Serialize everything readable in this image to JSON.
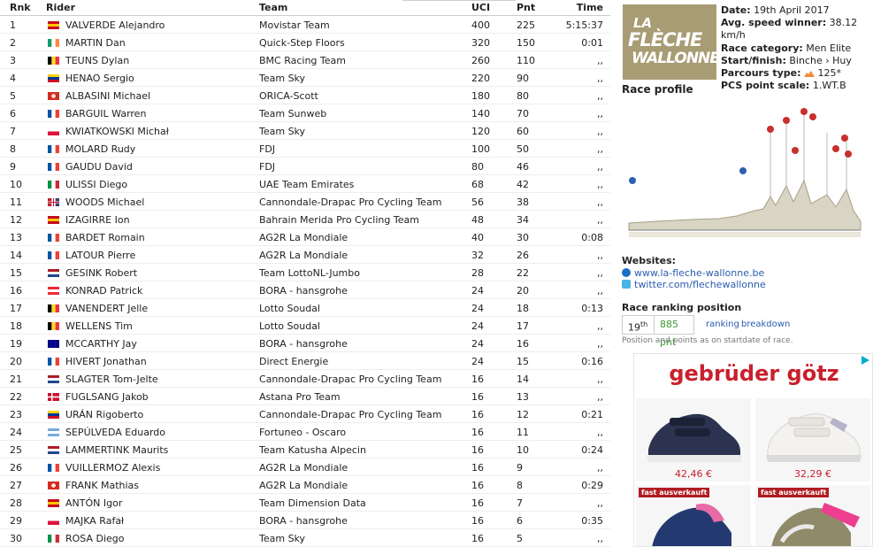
{
  "table": {
    "headers": {
      "rnk": "Rnk",
      "rider": "Rider",
      "team": "Team",
      "uci": "UCI",
      "pnt": "Pnt",
      "time": "Time"
    },
    "rows": [
      {
        "rnk": "1",
        "flag": "ES",
        "rider": "VALVERDE Alejandro",
        "team": "Movistar Team",
        "uci": "400",
        "pnt": "225",
        "time": "5:15:37"
      },
      {
        "rnk": "2",
        "flag": "IE",
        "rider": "MARTIN Dan",
        "team": "Quick-Step Floors",
        "uci": "320",
        "pnt": "150",
        "time": "0:01"
      },
      {
        "rnk": "3",
        "flag": "BE",
        "rider": "TEUNS Dylan",
        "team": "BMC Racing Team",
        "uci": "260",
        "pnt": "110",
        "time": ",,"
      },
      {
        "rnk": "4",
        "flag": "CO",
        "rider": "HENAO Sergio",
        "team": "Team Sky",
        "uci": "220",
        "pnt": "90",
        "time": ",,"
      },
      {
        "rnk": "5",
        "flag": "CH",
        "rider": "ALBASINI Michael",
        "team": "ORICA-Scott",
        "uci": "180",
        "pnt": "80",
        "time": ",,"
      },
      {
        "rnk": "6",
        "flag": "FR",
        "rider": "BARGUIL Warren",
        "team": "Team Sunweb",
        "uci": "140",
        "pnt": "70",
        "time": ",,"
      },
      {
        "rnk": "7",
        "flag": "PL",
        "rider": "KWIATKOWSKI Michał",
        "team": "Team Sky",
        "uci": "120",
        "pnt": "60",
        "time": ",,"
      },
      {
        "rnk": "8",
        "flag": "FR",
        "rider": "MOLARD Rudy",
        "team": "FDJ",
        "uci": "100",
        "pnt": "50",
        "time": ",,"
      },
      {
        "rnk": "9",
        "flag": "FR",
        "rider": "GAUDU David",
        "team": "FDJ",
        "uci": "80",
        "pnt": "46",
        "time": ",,"
      },
      {
        "rnk": "10",
        "flag": "IT",
        "rider": "ULISSI Diego",
        "team": "UAE Team Emirates",
        "uci": "68",
        "pnt": "42",
        "time": ",,"
      },
      {
        "rnk": "11",
        "flag": "GB",
        "rider": "WOODS Michael",
        "team": "Cannondale-Drapac Pro Cycling Team",
        "uci": "56",
        "pnt": "38",
        "time": ",,"
      },
      {
        "rnk": "12",
        "flag": "ES",
        "rider": "IZAGIRRE Ion",
        "team": "Bahrain Merida Pro Cycling Team",
        "uci": "48",
        "pnt": "34",
        "time": ",,"
      },
      {
        "rnk": "13",
        "flag": "FR",
        "rider": "BARDET Romain",
        "team": "AG2R La Mondiale",
        "uci": "40",
        "pnt": "30",
        "time": "0:08"
      },
      {
        "rnk": "14",
        "flag": "FR",
        "rider": "LATOUR Pierre",
        "team": "AG2R La Mondiale",
        "uci": "32",
        "pnt": "26",
        "time": ",,"
      },
      {
        "rnk": "15",
        "flag": "NL",
        "rider": "GESINK Robert",
        "team": "Team LottoNL-Jumbo",
        "uci": "28",
        "pnt": "22",
        "time": ",,"
      },
      {
        "rnk": "16",
        "flag": "AT",
        "rider": "KONRAD Patrick",
        "team": "BORA - hansgrohe",
        "uci": "24",
        "pnt": "20",
        "time": ",,"
      },
      {
        "rnk": "17",
        "flag": "BE",
        "rider": "VANENDERT Jelle",
        "team": "Lotto Soudal",
        "uci": "24",
        "pnt": "18",
        "time": "0:13"
      },
      {
        "rnk": "18",
        "flag": "BE",
        "rider": "WELLENS Tim",
        "team": "Lotto Soudal",
        "uci": "24",
        "pnt": "17",
        "time": ",,"
      },
      {
        "rnk": "19",
        "flag": "AU",
        "rider": "MCCARTHY Jay",
        "team": "BORA - hansgrohe",
        "uci": "24",
        "pnt": "16",
        "time": ",,"
      },
      {
        "rnk": "20",
        "flag": "FR",
        "rider": "HIVERT Jonathan",
        "team": "Direct Energie",
        "uci": "24",
        "pnt": "15",
        "time": "0:16"
      },
      {
        "rnk": "21",
        "flag": "NL",
        "rider": "SLAGTER Tom-Jelte",
        "team": "Cannondale-Drapac Pro Cycling Team",
        "uci": "16",
        "pnt": "14",
        "time": ",,"
      },
      {
        "rnk": "22",
        "flag": "DK",
        "rider": "FUGLSANG Jakob",
        "team": "Astana Pro Team",
        "uci": "16",
        "pnt": "13",
        "time": ",,"
      },
      {
        "rnk": "23",
        "flag": "CO",
        "rider": "URÁN Rigoberto",
        "team": "Cannondale-Drapac Pro Cycling Team",
        "uci": "16",
        "pnt": "12",
        "time": "0:21"
      },
      {
        "rnk": "24",
        "flag": "AR",
        "rider": "SEPÚLVEDA Eduardo",
        "team": "Fortuneo - Oscaro",
        "uci": "16",
        "pnt": "11",
        "time": ",,"
      },
      {
        "rnk": "25",
        "flag": "NL",
        "rider": "LAMMERTINK Maurits",
        "team": "Team Katusha Alpecin",
        "uci": "16",
        "pnt": "10",
        "time": "0:24"
      },
      {
        "rnk": "26",
        "flag": "FR",
        "rider": "VUILLERMOZ Alexis",
        "team": "AG2R La Mondiale",
        "uci": "16",
        "pnt": "9",
        "time": ",,"
      },
      {
        "rnk": "27",
        "flag": "CH",
        "rider": "FRANK Mathias",
        "team": "AG2R La Mondiale",
        "uci": "16",
        "pnt": "8",
        "time": "0:29"
      },
      {
        "rnk": "28",
        "flag": "ES",
        "rider": "ANTÓN Igor",
        "team": "Team Dimension Data",
        "uci": "16",
        "pnt": "7",
        "time": ",,"
      },
      {
        "rnk": "29",
        "flag": "PL",
        "rider": "MAJKA Rafał",
        "team": "BORA - hansgrohe",
        "uci": "16",
        "pnt": "6",
        "time": "0:35"
      },
      {
        "rnk": "30",
        "flag": "IT",
        "rider": "ROSA Diego",
        "team": "Team Sky",
        "uci": "16",
        "pnt": "5",
        "time": ",,"
      }
    ]
  },
  "flags": {
    "ES": [
      "#c60b1e",
      "#ffc400",
      "#c60b1e"
    ],
    "IE": [
      "#169b62",
      "#ffffff",
      "#ff883e"
    ],
    "BE": [
      "#000000",
      "#fdda24",
      "#ef3340"
    ],
    "CO": [
      "#fcd116",
      "#003893",
      "#ce1126"
    ],
    "CH": [
      "#d52b1e",
      "#d52b1e",
      "#d52b1e"
    ],
    "FR": [
      "#0055a4",
      "#ffffff",
      "#ef4135"
    ],
    "PL": [
      "#ffffff",
      "#dc143c"
    ],
    "IT": [
      "#009246",
      "#ffffff",
      "#ce2b37"
    ],
    "GB": [
      "#b22234",
      "#ffffff",
      "#3c3b6e"
    ],
    "NL": [
      "#ae1c28",
      "#ffffff",
      "#21468b"
    ],
    "AT": [
      "#ed2939",
      "#ffffff",
      "#ed2939"
    ],
    "AU": [
      "#00008b",
      "#00008b",
      "#00008b"
    ],
    "DK": [
      "#c8102e",
      "#c8102e",
      "#c8102e"
    ],
    "AR": [
      "#74acdf",
      "#ffffff",
      "#74acdf"
    ]
  },
  "race": {
    "logo": {
      "line1": "LA",
      "line2": "FLÈCHE",
      "line3": "WALLONNE"
    },
    "date_label": "Date:",
    "date": "19th April 2017",
    "speed_label": "Avg. speed winner:",
    "speed": "38.12 km/h",
    "category_label": "Race category:",
    "category": "Men Elite",
    "startfinish_label": "Start/finish:",
    "startfinish": "Binche › Huy",
    "parcours_label": "Parcours type:",
    "parcours": "125*",
    "pcs_label": "PCS point scale:",
    "pcs": "1.WT.B"
  },
  "profile": {
    "title": "Race profile"
  },
  "websites": {
    "title": "Websites:",
    "site": "www.la-fleche-wallonne.be",
    "twitter": "twitter.com/flechewallonne"
  },
  "ranking": {
    "title": "Race ranking position",
    "position": "19",
    "position_suffix": "th",
    "points": "885 pnt",
    "ranking_link": "ranking",
    "breakdown_link": "breakdown",
    "note": "Position and points as on startdate of race."
  },
  "ad": {
    "brand": "gebrüder götz",
    "price1": "42,46 €",
    "price2": "32,29 €",
    "badge1": "fast ausverkauft",
    "badge2": "fast ausverkauft",
    "colors": {
      "brand": "#c8202d",
      "price": "#c8202d"
    }
  }
}
